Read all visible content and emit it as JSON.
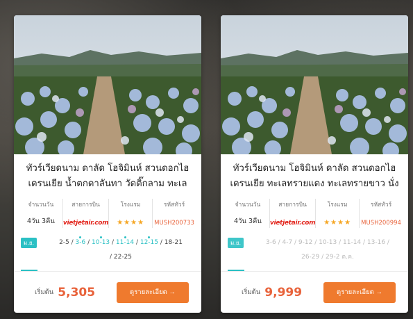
{
  "cards": [
    {
      "title_line1": "ทัวร์เวียดนาม ดาลัด โฮจิมินห์ สวนดอกไฮ",
      "title_line2": "เดรนเยีย น้ำตกดาลันทา วัดติ๊กลาม ทะเล",
      "info": {
        "days_label": "จำนวนวัน",
        "days_value": "4วัน 3คืน",
        "airline_label": "สายการบิน",
        "airline_value": "vietjetair.com",
        "hotel_label": "โรงแรม",
        "hotel_stars": "★★★★",
        "code_label": "รหัสทัวร์",
        "code_value": "MUSH200733"
      },
      "month": "ม.ย.",
      "dates_line1": [
        "2-5",
        "3-6",
        "10-13",
        "11-14",
        "12-15",
        "18-21"
      ],
      "dates_line2": "/ 22-25",
      "price_label": "เริ่มต้น",
      "price": "5,305",
      "button_label": "ดูรายละเอียด →"
    },
    {
      "title_line1": "ทัวร์เวียดนาม โฮจิมินห์ ดาลัด สวนดอกไฮ",
      "title_line2": "เดรนเยีย ทะเลทรายแดง ทะเลทรายขาว นั่ง",
      "info": {
        "days_label": "จำนวนวัน",
        "days_value": "4วัน 3คืน",
        "airline_label": "สายการบิน",
        "airline_value": "vietjetair.com",
        "hotel_label": "โรงแรม",
        "hotel_stars": "★★★★",
        "code_label": "รหัสทัวร์",
        "code_value": "MUSH200994"
      },
      "month": "ม.ย.",
      "dates_line1": "3-6 / 4-7 / 9-12 / 10-13 / 11-14 / 13-16 /",
      "dates_line2": "26-29 / 29-2 ต.ค.",
      "price_label": "เริ่มต้น",
      "price": "9,999",
      "button_label": "ดูรายละเอียด →"
    }
  ]
}
